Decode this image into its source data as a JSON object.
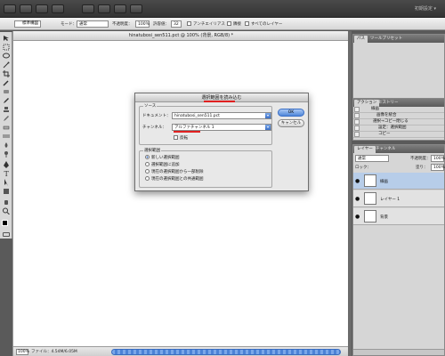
{
  "app": {
    "workspace_label": "初期設定 ▾"
  },
  "options_bar": {
    "style_value": "標準構図",
    "mode_label": "モード：",
    "mode_value": "通常",
    "opacity_label": "不透明度：",
    "opacity_value": "100%",
    "tolerance_label": "許容値：",
    "tolerance_value": "32",
    "antialias_label": "アンチエイリアス",
    "contiguous_label": "隣接",
    "all_layers_label": "すべてのレイヤー"
  },
  "document": {
    "title": "hinatubosi_sen511.pct @ 100% (背景, RGB/8) *",
    "zoom": "100%",
    "file_info": "ファイル：4.54M/6.05M"
  },
  "dialog": {
    "title": "選択範囲を読み込む",
    "source_group": "ソース",
    "document_label": "ドキュメント：",
    "document_value": "hinatubosi_sen511.pct",
    "channel_label": "チャンネル：",
    "channel_value": "アルファチャンネル 1",
    "invert_label": "反転",
    "operation_group": "選択範囲",
    "options": [
      "新しい選択範囲",
      "選択範囲に追加",
      "現在の選択範囲から一部削除",
      "現在の選択範囲との共通範囲"
    ],
    "ok_label": "OK",
    "cancel_label": "キャンセル"
  },
  "panels": {
    "paths_tabs": [
      "パス",
      "ツールプリセット"
    ],
    "actions_tabs": [
      "アクション",
      "ヒストリー"
    ],
    "actions": [
      "線画",
      "画像を統合",
      "選択→コピー閉じる",
      "設定：選択範囲",
      "コピー"
    ],
    "layers_tabs": [
      "レイヤー",
      "チャンネル"
    ],
    "blend_mode": "通常",
    "opacity_label": "不透明度：",
    "opacity_value": "100%",
    "lock_label": "ロック：",
    "fill_label": "塗り：",
    "fill_value": "100%",
    "layers": [
      "線画",
      "レイヤー 1",
      "背景"
    ]
  },
  "colors": {
    "selection_highlight": "#b7cde9",
    "accent_blue": "#4f86d9",
    "annotation_red": "#e02020"
  }
}
